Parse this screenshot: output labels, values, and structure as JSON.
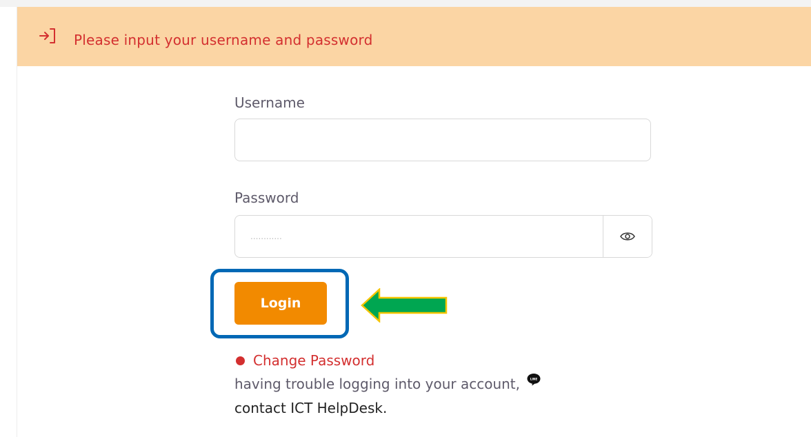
{
  "header": {
    "message": "Please input your username and password",
    "icon": "login-icon",
    "background_color": "#fbd5a4",
    "text_color": "#d32f2f"
  },
  "form": {
    "username_label": "Username",
    "username_value": "",
    "password_label": "Password",
    "password_placeholder": "............",
    "toggle_icon": "eye-icon",
    "login_label": "Login",
    "login_color": "#f28a00"
  },
  "annotations": {
    "highlight_color": "#0068b5",
    "arrow_color": "#00a651",
    "arrow_outline_color": "#f5c400"
  },
  "links": {
    "change_password": "Change Password",
    "trouble_text": "having trouble logging into your account,",
    "line_icon": "line-chat-icon",
    "helpdesk": "contact ICT HelpDesk."
  }
}
